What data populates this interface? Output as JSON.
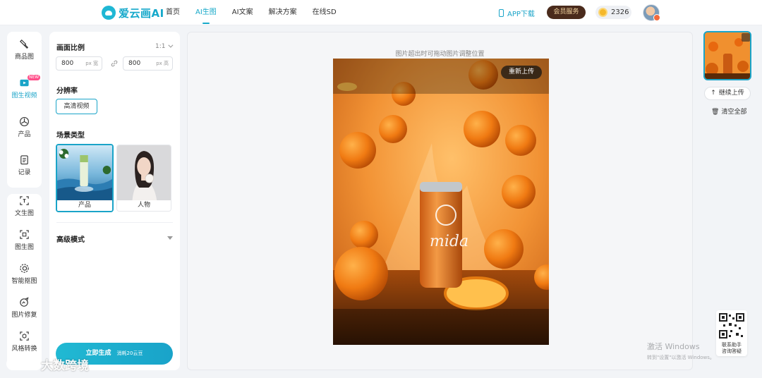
{
  "header": {
    "logo_text": "爱云画AI",
    "nav": [
      {
        "label": "首页",
        "active": false
      },
      {
        "label": "AI生图",
        "active": true
      },
      {
        "label": "AI文案",
        "active": false
      },
      {
        "label": "解决方案",
        "active": false
      },
      {
        "label": "在线SD",
        "active": false
      }
    ],
    "app_download": "APP下载",
    "vip_button": "会员服务",
    "coin_count": "2326"
  },
  "sidebar": {
    "group1": [
      {
        "label": "商品图",
        "icon": "brush-icon",
        "active": false
      },
      {
        "label": "图生视频",
        "icon": "video-icon",
        "active": true,
        "badge": "NEW"
      },
      {
        "label": "产品",
        "icon": "product-icon",
        "active": false
      },
      {
        "label": "记录",
        "icon": "record-icon",
        "active": false
      }
    ],
    "group2": [
      {
        "label": "文生图",
        "icon": "text-to-image-icon"
      },
      {
        "label": "图生图",
        "icon": "image-to-image-icon"
      },
      {
        "label": "智能抠图",
        "icon": "cutout-icon"
      },
      {
        "label": "图片修复",
        "icon": "repair-icon"
      },
      {
        "label": "风格转换",
        "icon": "style-icon"
      }
    ]
  },
  "settings": {
    "ratio_title": "画面比例",
    "ratio_value": "1:1",
    "width_value": "800",
    "width_unit": "px 宽",
    "height_value": "800",
    "height_unit": "px 高",
    "resolution_title": "分辨率",
    "resolution_option": "高清视频",
    "scene_title": "场景类型",
    "scenes": [
      {
        "label": "产品",
        "selected": true
      },
      {
        "label": "人物",
        "selected": false
      }
    ],
    "advanced_title": "高级模式",
    "generate_label": "立即生成",
    "generate_cost": "消耗20云豆"
  },
  "canvas": {
    "hint": "图片超出时可拖动图片调整位置",
    "reupload_label": "重新上传",
    "can_text": "mida"
  },
  "right_panel": {
    "continue_upload": "继续上传",
    "clear_all": "清空全部",
    "qr_caption_line1": "联系助手",
    "qr_caption_line2": "咨询答疑"
  },
  "watermarks": {
    "windows_line1": "激活 Windows",
    "windows_line2": "转到\"设置\"以激活 Windows。",
    "site": "大数跨境"
  },
  "colors": {
    "accent": "#1aa4c8",
    "vip_bg": "#4a2b1c",
    "vip_text": "#f7d9a4",
    "badge_new": "#ff4d88"
  }
}
